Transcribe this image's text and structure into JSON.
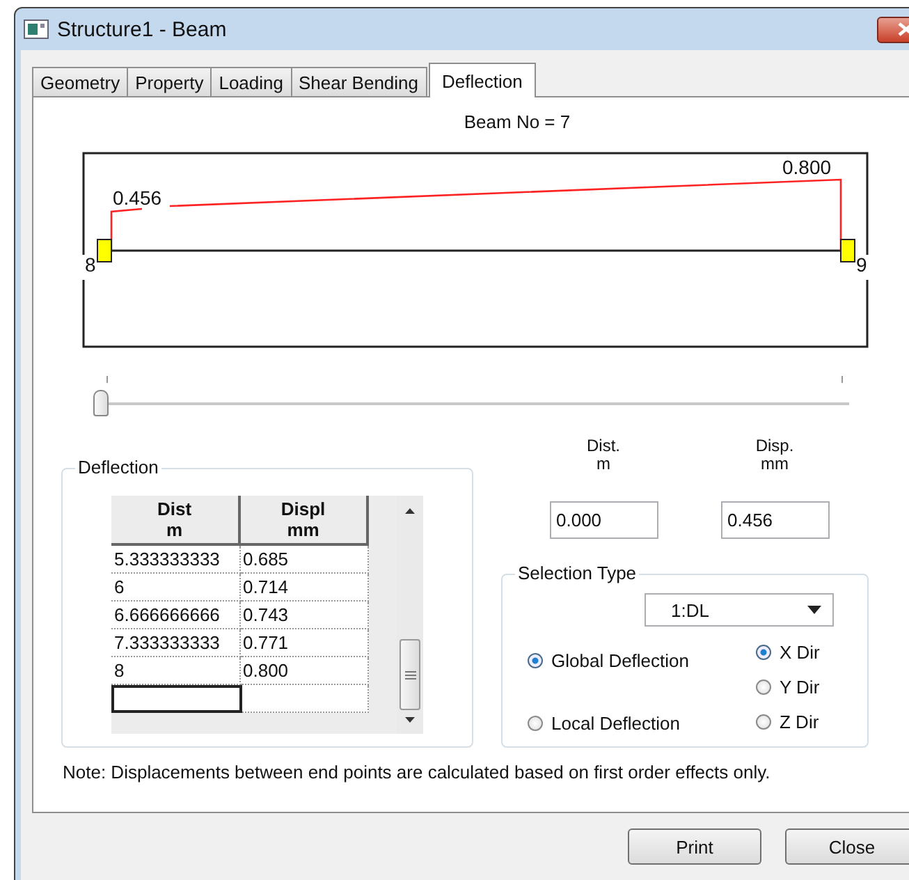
{
  "window": {
    "title": "Structure1 - Beam"
  },
  "tabs": [
    {
      "label": "Geometry",
      "selected": false
    },
    {
      "label": "Property",
      "selected": false
    },
    {
      "label": "Loading",
      "selected": false
    },
    {
      "label": "Shear Bending",
      "selected": false
    },
    {
      "label": "Deflection",
      "selected": true
    }
  ],
  "beam_label": "Beam No = 7",
  "diagram": {
    "start_value": "0.456",
    "end_value": "0.800",
    "start_node": "8",
    "end_node": "9"
  },
  "slider": {
    "level": 0
  },
  "deflection_group": {
    "title": "Deflection",
    "columns": [
      {
        "name": "Dist",
        "unit": "m"
      },
      {
        "name": "Displ",
        "unit": "mm"
      }
    ],
    "rows": [
      [
        "5.333333333",
        "0.685"
      ],
      [
        "6",
        "0.714"
      ],
      [
        "6.666666666",
        "0.743"
      ],
      [
        "7.333333333",
        "0.771"
      ],
      [
        "8",
        "0.800"
      ]
    ]
  },
  "readouts": [
    {
      "name": "Dist.",
      "unit": "m",
      "value": "0.000"
    },
    {
      "name": "Disp.",
      "unit": "mm",
      "value": "0.456"
    }
  ],
  "selection_type": {
    "title": "Selection Type",
    "dropdown": "1:DL",
    "deflection_options": [
      {
        "label": "Global Deflection",
        "selected": true
      },
      {
        "label": "Local Deflection",
        "selected": false
      }
    ],
    "direction_options": [
      {
        "label": "X Dir",
        "selected": true
      },
      {
        "label": "Y Dir",
        "selected": false
      },
      {
        "label": "Z Dir",
        "selected": false
      }
    ]
  },
  "note": "Note: Displacements between end points are calculated based on first order effects only.",
  "buttons": [
    "Print",
    "Close"
  ]
}
